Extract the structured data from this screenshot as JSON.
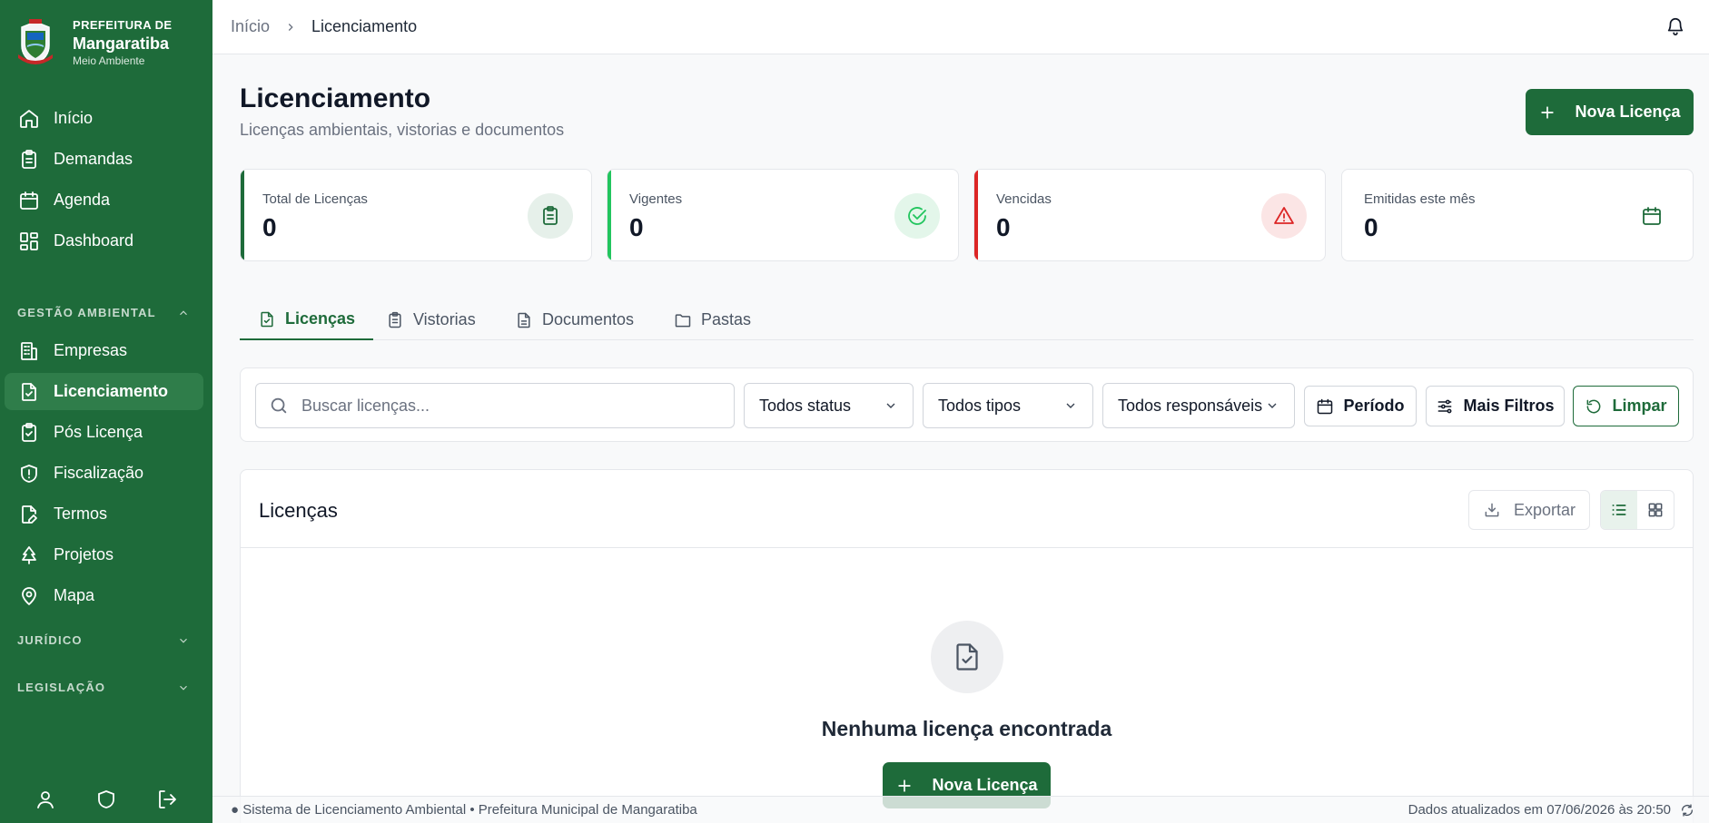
{
  "brand": {
    "top": "PREFEITURA DE",
    "name": "Mangaratiba",
    "sub": "Meio Ambiente"
  },
  "nav": {
    "inicio": "Início",
    "demandas": "Demandas",
    "agenda": "Agenda",
    "dashboard": "Dashboard",
    "empresas": "Empresas",
    "licenciamento": "Licenciamento",
    "pos_licenca": "Pós Licença",
    "fiscalizacao": "Fiscalização",
    "termos": "Termos",
    "projetos": "Projetos",
    "mapa": "Mapa"
  },
  "sections": {
    "gestao": "GESTÃO AMBIENTAL",
    "juridico": "JURÍDICO",
    "legislacao": "LEGISLAÇÃO"
  },
  "breadcrumb": {
    "home": "Início",
    "current": "Licenciamento"
  },
  "header": {
    "title": "Licenciamento",
    "subtitle": "Licenças ambientais, vistorias e documentos",
    "new_button": "Nova Licença"
  },
  "stats": [
    {
      "label": "Total de Licenças",
      "value": "0",
      "color": "#1e6b3a"
    },
    {
      "label": "Vigentes",
      "value": "0",
      "color": "#22c55e"
    },
    {
      "label": "Vencidas",
      "value": "0",
      "color": "#dc2626"
    },
    {
      "label": "Emitidas este mês",
      "value": "0",
      "color": "#1e6b3a"
    }
  ],
  "tabs": [
    {
      "label": "Licenças",
      "icon": "file-check-icon"
    },
    {
      "label": "Vistorias",
      "icon": "clipboard-icon"
    },
    {
      "label": "Documentos",
      "icon": "document-icon"
    },
    {
      "label": "Pastas",
      "icon": "folder-icon"
    }
  ],
  "filters": {
    "search_placeholder": "Buscar licenças...",
    "status": "Todos status",
    "tipos": "Todos tipos",
    "responsaveis": "Todos responsáveis",
    "periodo": "Período",
    "mais_filtros": "Mais Filtros",
    "limpar": "Limpar"
  },
  "panel": {
    "title": "Licenças",
    "export": "Exportar",
    "empty": "Nenhuma licença encontrada",
    "empty_button": "Nova Licença"
  },
  "footer": {
    "left": "● Sistema de Licenciamento Ambiental • Prefeitura Municipal de Mangaratiba",
    "right": "Dados atualizados em 07/06/2026 às 20:50"
  },
  "colors": {
    "primary": "#1e6b3a",
    "success": "#22c55e",
    "danger": "#dc2626"
  }
}
